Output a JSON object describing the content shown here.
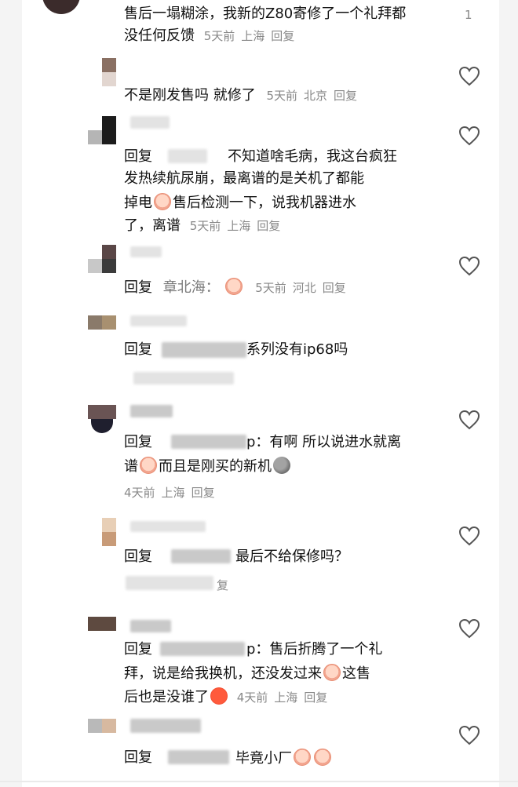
{
  "comments": [
    {
      "id": "c0",
      "lines": [
        "售后一塌糊涂，我新的Z80寄修了一个礼拜都",
        "没任何反馈"
      ],
      "meta": {
        "time": "5天前",
        "location": "上海",
        "reply": "回复"
      },
      "like_count": "1"
    },
    {
      "id": "c1",
      "lines": [
        "不是刚发售吗 就修了"
      ],
      "meta": {
        "time": "5天前",
        "location": "北京",
        "reply": "回复"
      }
    },
    {
      "id": "c2",
      "reply_prefix": "回复",
      "lines": [
        "不知道啥毛病，我这台疯狂",
        "发热续航尿崩，最离谱的是关机了都能",
        "掉电",
        "售后检测一下，说我机器进水",
        "了，离谱"
      ],
      "meta": {
        "time": "5天前",
        "location": "上海",
        "reply": "回复"
      }
    },
    {
      "id": "c3",
      "reply_prefix": "回复",
      "reply_to": "章北海：",
      "meta": {
        "time": "5天前",
        "location": "河北",
        "reply": "回复"
      }
    },
    {
      "id": "c4",
      "reply_prefix": "回复",
      "tail": "系列没有ip68吗"
    },
    {
      "id": "c5",
      "reply_prefix": "回复",
      "lines": [
        "p：有啊 所以说进水就离",
        "谱",
        "而且是刚买的新机"
      ],
      "meta": {
        "time": "4天前",
        "location": "上海",
        "reply": "回复"
      }
    },
    {
      "id": "c6",
      "reply_prefix": "回复",
      "text": "最后不给保修吗？",
      "meta_reply_visible": "复"
    },
    {
      "id": "c7",
      "reply_prefix": "回复",
      "lines": [
        "p：售后折腾了一个礼",
        "拜，说是给我换机，还没发过来",
        "这售",
        "后也是没谁了"
      ],
      "meta": {
        "time": "4天前",
        "location": "上海",
        "reply": "回复"
      }
    },
    {
      "id": "c8",
      "reply_prefix": "回复",
      "text": "毕竟小厂"
    }
  ],
  "icons": {
    "like": "heart-outline-icon",
    "emoji_cry": "crying-face-emoji",
    "emoji_rock": "rock-face-emoji",
    "emoji_red": "angry-red-face-emoji"
  },
  "colors": {
    "text": "#111111",
    "meta": "#888888",
    "heart_stroke": "#555555"
  }
}
